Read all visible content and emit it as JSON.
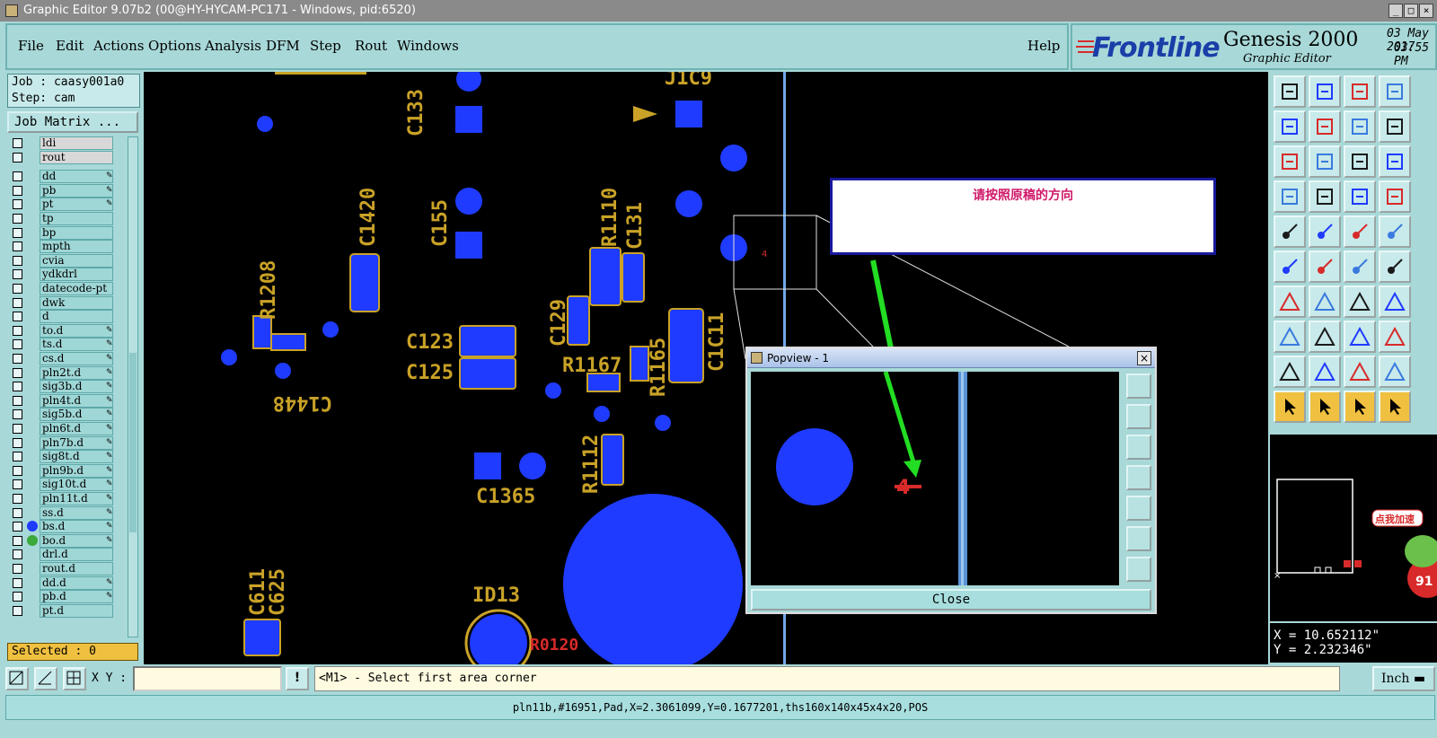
{
  "window": {
    "title": "Graphic Editor 9.07b2 (00@HY-HYCAM-PC171 - Windows, pid:6520)"
  },
  "menu": {
    "items": [
      "File",
      "Edit",
      "Actions",
      "Options",
      "Analysis",
      "DFM",
      "Step",
      "Rout",
      "Windows"
    ],
    "help": "Help"
  },
  "brand": {
    "logo": "Frontline",
    "product": "Genesis 2000",
    "subtitle": "Graphic Editor",
    "date": "03 May 2017",
    "time": "03:55 PM"
  },
  "job": {
    "job_line": "Job : caasy001a0",
    "step_line": "Step: cam",
    "matrix_button": "Job Matrix ..."
  },
  "layers": [
    {
      "name": "ldi",
      "type": "board"
    },
    {
      "name": "rout",
      "type": "board"
    },
    {
      "name": "dd",
      "pen": true
    },
    {
      "name": "pb",
      "pen": true
    },
    {
      "name": "pt",
      "pen": true
    },
    {
      "name": "tp"
    },
    {
      "name": "bp"
    },
    {
      "name": "mpth"
    },
    {
      "name": "cvia"
    },
    {
      "name": "ydkdrl"
    },
    {
      "name": "datecode-pt"
    },
    {
      "name": "dwk"
    },
    {
      "name": "d"
    },
    {
      "name": "to.d",
      "pen": true
    },
    {
      "name": "ts.d",
      "pen": true
    },
    {
      "name": "cs.d",
      "pen": true
    },
    {
      "name": "pln2t.d",
      "pen": true
    },
    {
      "name": "sig3b.d",
      "pen": true
    },
    {
      "name": "pln4t.d",
      "pen": true
    },
    {
      "name": "sig5b.d",
      "pen": true
    },
    {
      "name": "pln6t.d",
      "pen": true
    },
    {
      "name": "pln7b.d",
      "pen": true
    },
    {
      "name": "sig8t.d",
      "pen": true
    },
    {
      "name": "pln9b.d",
      "pen": true
    },
    {
      "name": "sig10t.d",
      "pen": true
    },
    {
      "name": "pln11t.d",
      "pen": true
    },
    {
      "name": "ss.d",
      "pen": true
    },
    {
      "name": "bs.d",
      "pen": true,
      "color": "#1f3bff"
    },
    {
      "name": "bo.d",
      "pen": true,
      "color": "#3aa83a"
    },
    {
      "name": "drl.d"
    },
    {
      "name": "rout.d"
    },
    {
      "name": "dd.d",
      "pen": true
    },
    {
      "name": "pb.d",
      "pen": true
    },
    {
      "name": "pt.d"
    }
  ],
  "selected": "Selected : 0",
  "canvas_labels": [
    "C133",
    "C155",
    "C1420",
    "R1208",
    "C1448",
    "C123",
    "C125",
    "R1110",
    "C131",
    "C129",
    "R1167",
    "R1165",
    "C1C11",
    "R1112",
    "C1365",
    "ID13",
    "C611",
    "C625",
    "J1C9"
  ],
  "note": {
    "text": "请按照原稿的方向"
  },
  "popview": {
    "title": "Popview - 1",
    "close_label": "Close"
  },
  "coords": {
    "x": "X = 10.652112\"",
    "y": "Y = 2.232346\""
  },
  "overview_badge": "点我加速",
  "overview_badge_num": "91",
  "cmd": {
    "xy_label": "X Y :",
    "xy_value": "",
    "message": "<M1> - Select first area corner",
    "unit": "Inch"
  },
  "status": "pln11b,#16951,Pad,X=2.3061099,Y=0.1677201,ths160x140x45x4x20,POS",
  "colors": {
    "pad": "#1f3bff",
    "silk": "#c9a227",
    "panel": "#a8d8d8",
    "accent": "#f0c040"
  }
}
